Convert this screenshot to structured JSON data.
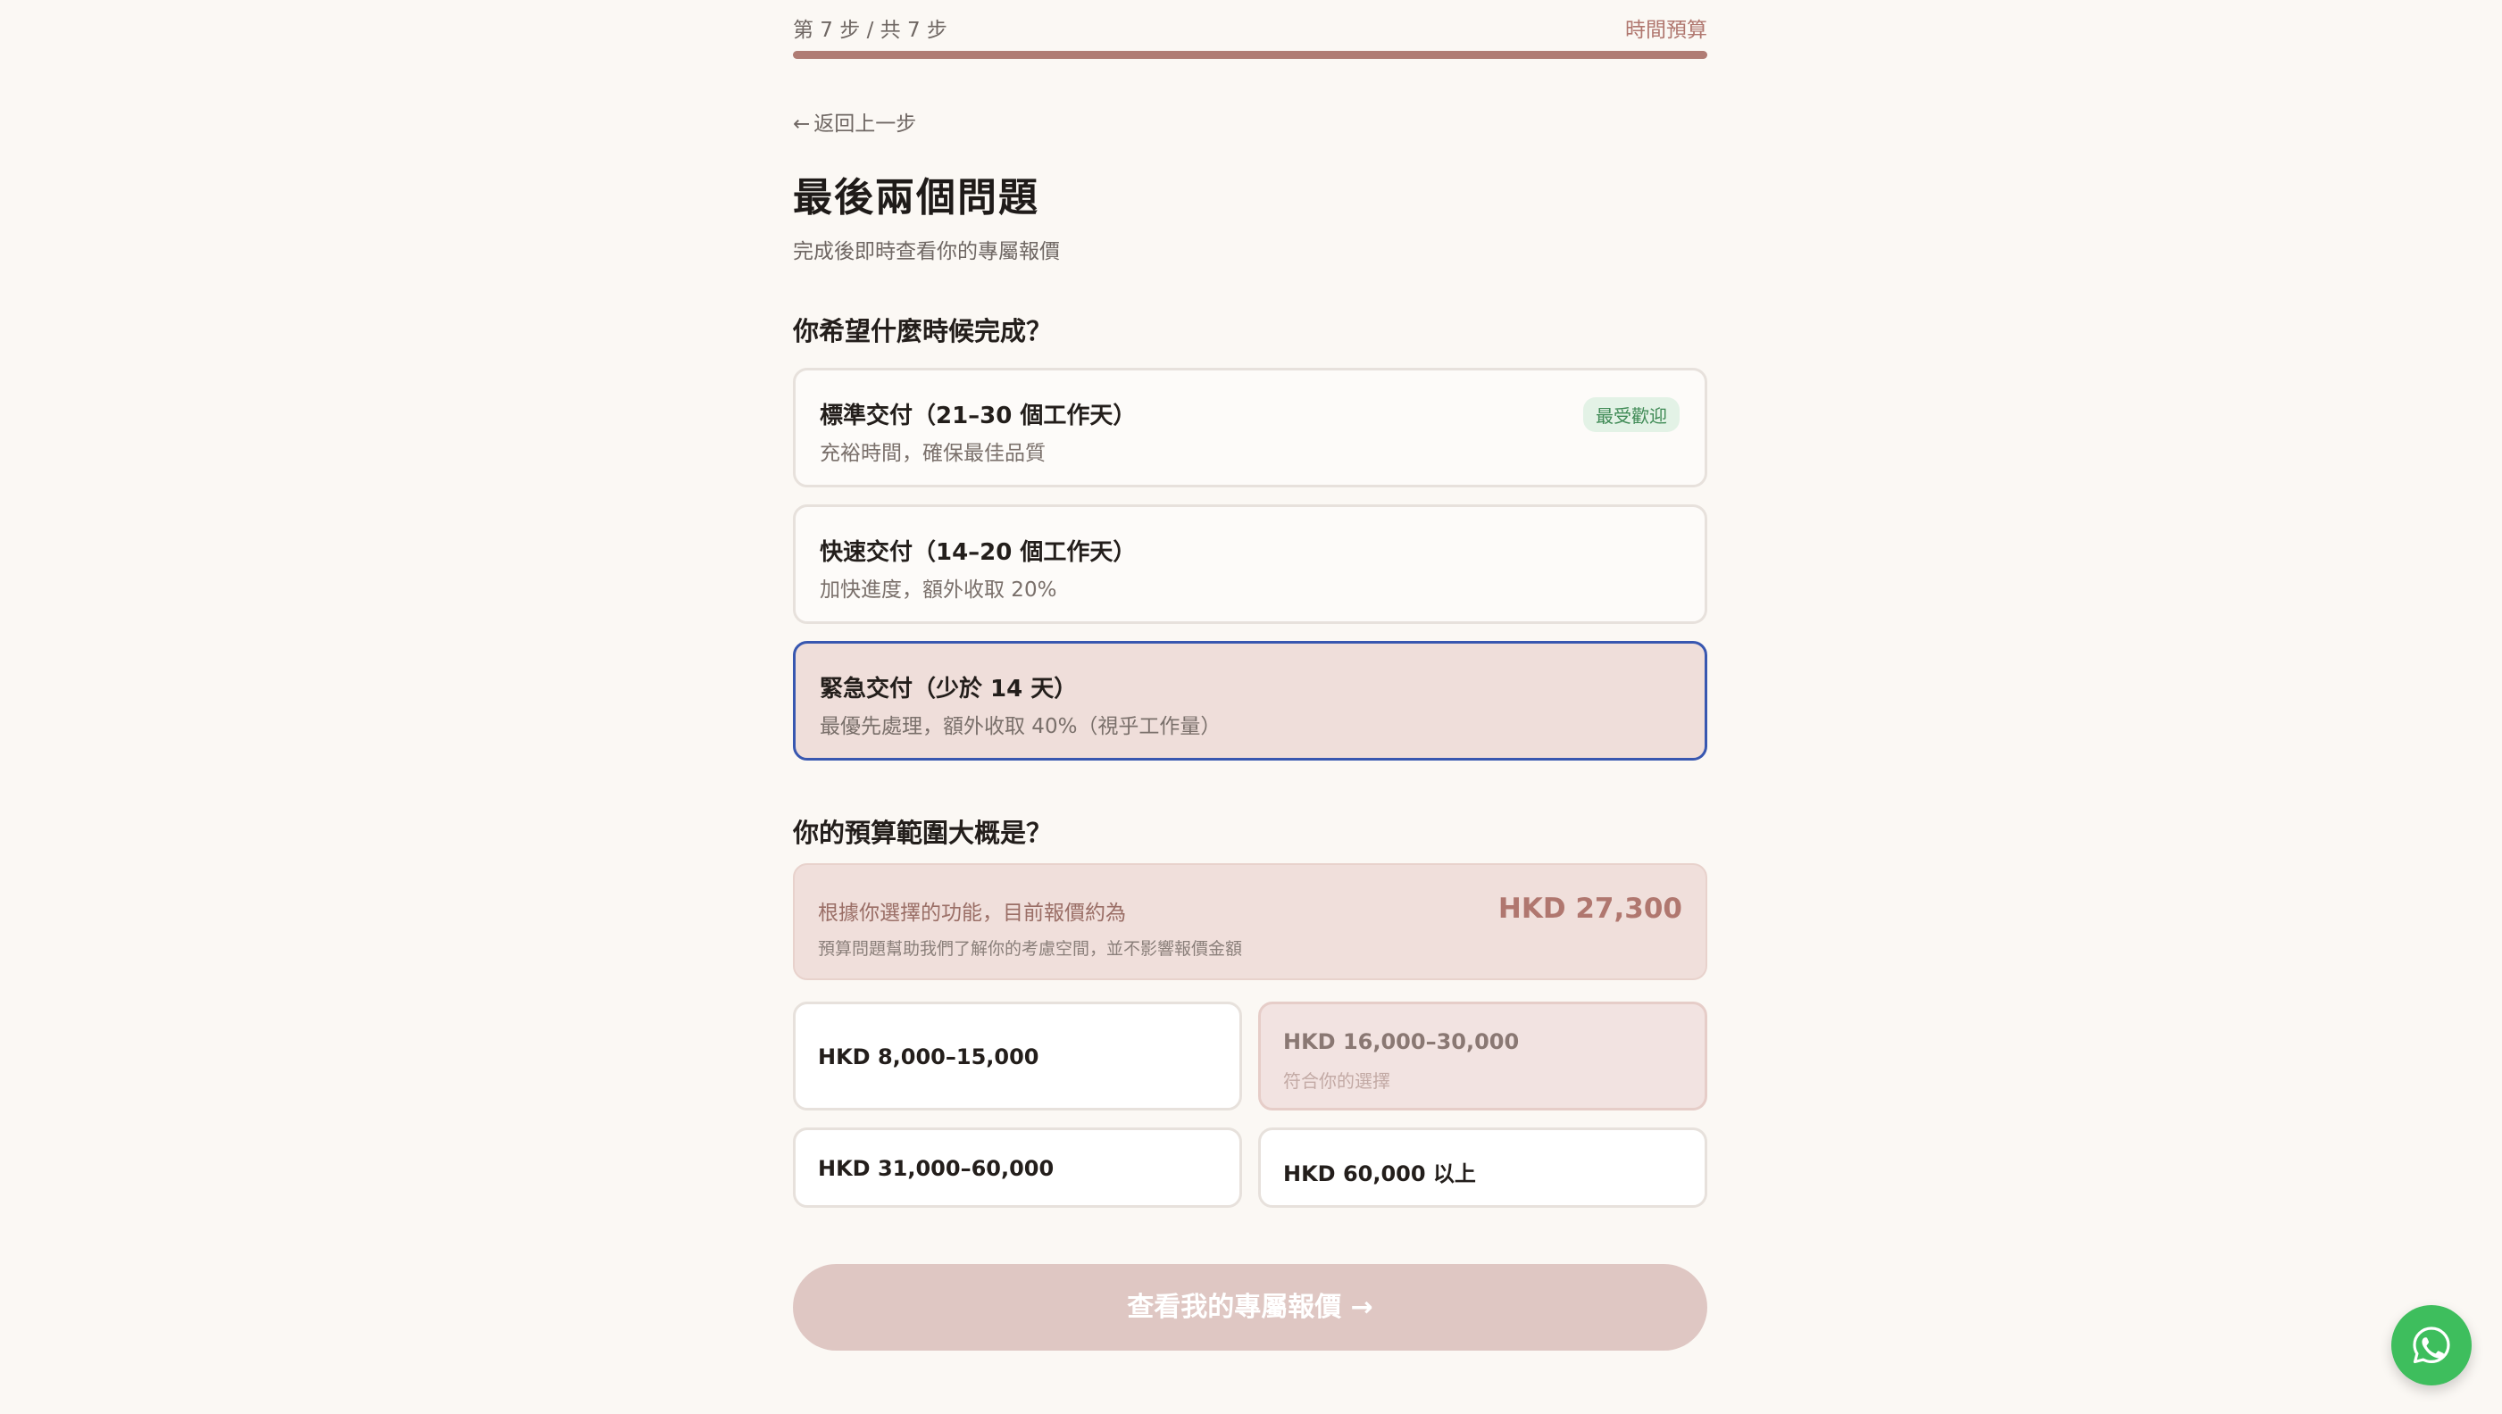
{
  "progress": {
    "step_text": "第 7 步 / 共 7 步",
    "section_label": "時間預算",
    "fraction": 1.0
  },
  "back_label": "返回上一步",
  "back_arrow": "←",
  "title": "最後兩個問題",
  "subtitle": "完成後即時查看你的專屬報價",
  "timeline": {
    "question": "你希望什麼時候完成？",
    "options": [
      {
        "title": "標準交付（21–30 個工作天）",
        "desc": "充裕時間，確保最佳品質",
        "badge": "最受歡迎",
        "selected": false
      },
      {
        "title": "快速交付（14–20 個工作天）",
        "desc": "加快進度，額外收取 20%",
        "selected": false
      },
      {
        "title": "緊急交付（少於 14 天）",
        "desc": "最優先處理，額外收取 40%（視乎工作量）",
        "selected": true
      }
    ]
  },
  "budget": {
    "question": "你的預算範圍大概是？",
    "quote_label": "根據你選擇的功能，目前報價約為",
    "quote_price": "HKD 27,300",
    "quote_note": "預算問題幫助我們了解你的考慮空間，並不影響報價金額",
    "options": [
      {
        "label": "HKD 8,000–15,000"
      },
      {
        "label": "HKD 16,000–30,000",
        "sub": "符合你的選擇"
      },
      {
        "label": "HKD 31,000–60,000"
      },
      {
        "label": "HKD 60,000 以上"
      }
    ]
  },
  "cta_label": "查看我的專屬報價 →",
  "icons": {
    "whatsapp": "whatsapp-icon"
  },
  "colors": {
    "accent": "#b07c74",
    "selected_border": "#3857b0",
    "whatsapp": "#3ebe5d"
  }
}
